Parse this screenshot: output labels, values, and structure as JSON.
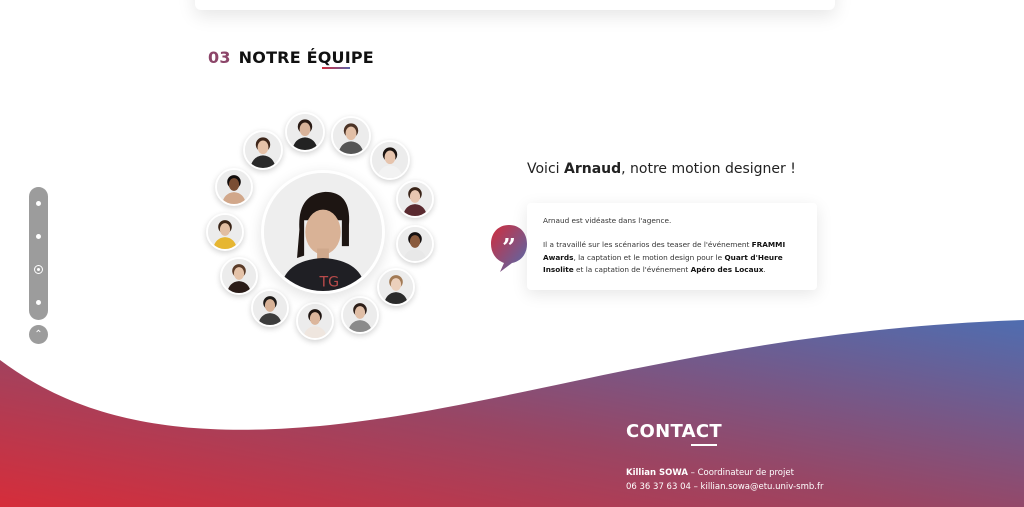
{
  "section": {
    "number": "03",
    "title": "NOTRE ÉQUIPE"
  },
  "featured": {
    "intro_prefix": "Voici ",
    "name": "Arnaud",
    "intro_suffix": ", notre motion designer !",
    "bio_p1": "Arnaud est vidéaste dans l'agence.",
    "bio_p2_a": "Il a travaillé sur les scénarios des teaser de l'événement ",
    "bio_p2_b": "FRAMMI Awards",
    "bio_p2_c": ", la captation et le motion design pour le ",
    "bio_p2_d": "Quart d'Heure Insolite",
    "bio_p2_e": " et la captation de l'événement ",
    "bio_p2_f": "Apéro des Locaux",
    "bio_p2_g": "."
  },
  "team_members": [
    {
      "id": "m1",
      "hair": "#2a1a14",
      "skin": "#d8b39a",
      "shirt": "#222222"
    },
    {
      "id": "m2",
      "hair": "#4a3225",
      "skin": "#e2bfa6",
      "shirt": "#555555"
    },
    {
      "id": "m3",
      "hair": "#1c1411",
      "skin": "#e6c4ad",
      "shirt": "#f2f2f2"
    },
    {
      "id": "m4",
      "hair": "#3a2418",
      "skin": "#e8c6b0",
      "shirt": "#5a2a30"
    },
    {
      "id": "m5",
      "hair": "#151010",
      "skin": "#8a5a3c",
      "shirt": "#e8e8e8"
    },
    {
      "id": "m6",
      "hair": "#a27a55",
      "skin": "#ecd0bc",
      "shirt": "#2b2b2b"
    },
    {
      "id": "m7",
      "hair": "#2c1e18",
      "skin": "#e0bea6",
      "shirt": "#8a8a8a"
    },
    {
      "id": "m8",
      "hair": "#201612",
      "skin": "#dcb69c",
      "shirt": "#efe6df"
    },
    {
      "id": "m9",
      "hair": "#1e1a18",
      "skin": "#d7b196",
      "shirt": "#3c3c3c"
    },
    {
      "id": "m10",
      "hair": "#5a3b28",
      "skin": "#e4c2a8",
      "shirt": "#2a1c18"
    },
    {
      "id": "m11",
      "hair": "#3a2416",
      "skin": "#e2bea2",
      "shirt": "#e6b632"
    },
    {
      "id": "m12",
      "hair": "#120d0c",
      "skin": "#7a4e34",
      "shirt": "#d1a78a"
    },
    {
      "id": "m13",
      "hair": "#3e261a",
      "skin": "#e6c2a8",
      "shirt": "#2a2a2a"
    }
  ],
  "nav": {
    "scroll_top_icon": "chevron-up-icon"
  },
  "contact": {
    "title": "CONTACT",
    "name": "Killian SOWA",
    "role": " – Coordinateur de projet",
    "phone_email": "06 36 37 63 04 – killian.sowa@etu.univ-smb.fr"
  },
  "colors": {
    "accent_red": "#d12c3c",
    "accent_blue": "#4f6db0",
    "section_number": "#8c4569"
  }
}
